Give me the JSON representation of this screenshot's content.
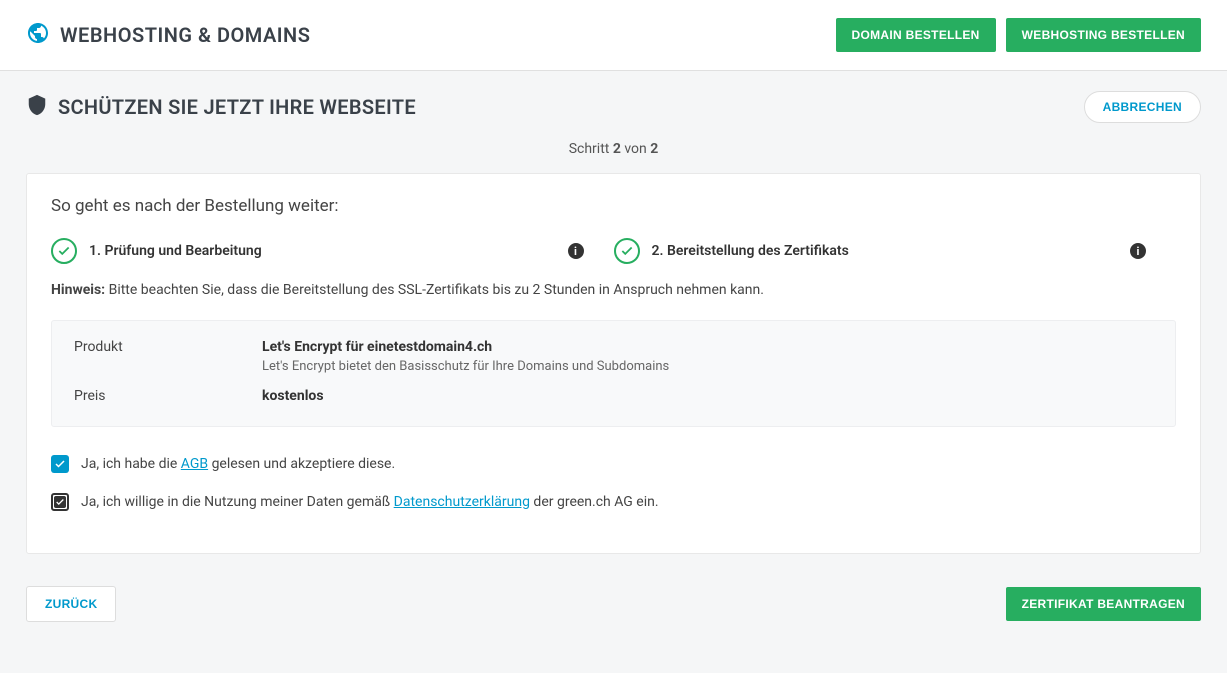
{
  "topBar": {
    "title": "WEBHOSTING & DOMAINS",
    "orderDomainButton": "DOMAIN BESTELLEN",
    "orderHostingButton": "WEBHOSTING BESTELLEN"
  },
  "pageHeader": {
    "title": "SCHÜTZEN SIE JETZT IHRE WEBSEITE",
    "cancelButton": "ABBRECHEN"
  },
  "stepIndicator": {
    "prefix": "Schritt ",
    "current": "2",
    "middle": " von ",
    "total": "2"
  },
  "card": {
    "heading": "So geht es nach der Bestellung weiter:",
    "steps": [
      {
        "label": "1. Prüfung und Bearbeitung"
      },
      {
        "label": "2. Bereitstellung des Zertifikats"
      }
    ],
    "hint": {
      "label": "Hinweis:",
      "text": " Bitte beachten Sie, dass die Bereitstellung des SSL-Zertifikats bis zu 2 Stunden in Anspruch nehmen kann."
    },
    "productBox": {
      "productLabel": "Produkt",
      "productValue": "Let's Encrypt für einetestdomain4.ch",
      "productDesc": "Let's Encrypt bietet den Basisschutz für Ihre Domains und Subdomains",
      "priceLabel": "Preis",
      "priceValue": "kostenlos"
    },
    "agb": {
      "prefix": "Ja, ich habe die ",
      "link": "AGB",
      "suffix": " gelesen und akzeptiere diese."
    },
    "privacy": {
      "prefix": "Ja, ich willige in die Nutzung meiner Daten gemäß ",
      "link": "Datenschutzerklärung",
      "suffix": " der green.ch AG ein."
    }
  },
  "footer": {
    "backButton": "ZURÜCK",
    "submitButton": "ZERTIFIKAT BEANTRAGEN"
  }
}
